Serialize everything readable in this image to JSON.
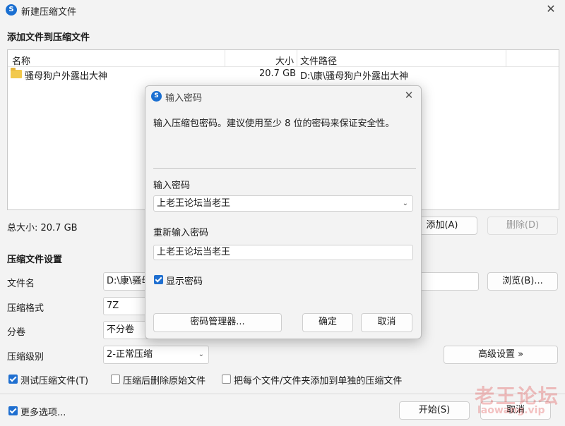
{
  "window": {
    "title": "新建压缩文件",
    "app_icon_glyph": "S"
  },
  "add_section": {
    "title": "添加文件到压缩文件",
    "columns": {
      "name": "名称",
      "size": "大小",
      "path": "文件路径"
    },
    "rows": [
      {
        "name": "骚母狗户外露出大神",
        "size": "20.7 GB",
        "path": "D:\\康\\骚母狗户外露出大神"
      }
    ],
    "total_size": "总大小: 20.7 GB",
    "add_button": "添加(A)",
    "delete_button": "删除(D)"
  },
  "settings": {
    "title": "压缩文件设置",
    "filename_label": "文件名",
    "filename_value": "D:\\康\\骚母",
    "browse_button": "浏览(B)...",
    "format_label": "压缩格式",
    "format_value": "7Z",
    "split_label": "分卷",
    "split_value": "不分卷",
    "level_label": "压缩级别",
    "level_value": "2-正常压缩",
    "advanced_button": "高级设置 »",
    "test_label": "测试压缩文件(T)",
    "delete_after_label": "压缩后删除原始文件",
    "separate_label": "把每个文件/文件夹添加到单独的压缩文件",
    "more_options_label": "更多选项...",
    "start_button": "开始(S)",
    "cancel_button": "取消"
  },
  "dialog": {
    "title": "输入密码",
    "hint": "输入压缩包密码。建议使用至少 8 位的密码来保证安全性。",
    "password_label": "输入密码",
    "password_value": "上老王论坛当老王",
    "repeat_label": "重新输入密码",
    "repeat_value": "上老王论坛当老王",
    "show_password_label": "显示密码",
    "manager_button": "密码管理器...",
    "ok_button": "确定",
    "cancel_button": "取消"
  },
  "watermark": {
    "text": "老王论坛",
    "url": "laowang.vip"
  },
  "colors": {
    "accent": "#1f6fd0",
    "background": "#f3f3f3",
    "watermark": "#e05050"
  }
}
